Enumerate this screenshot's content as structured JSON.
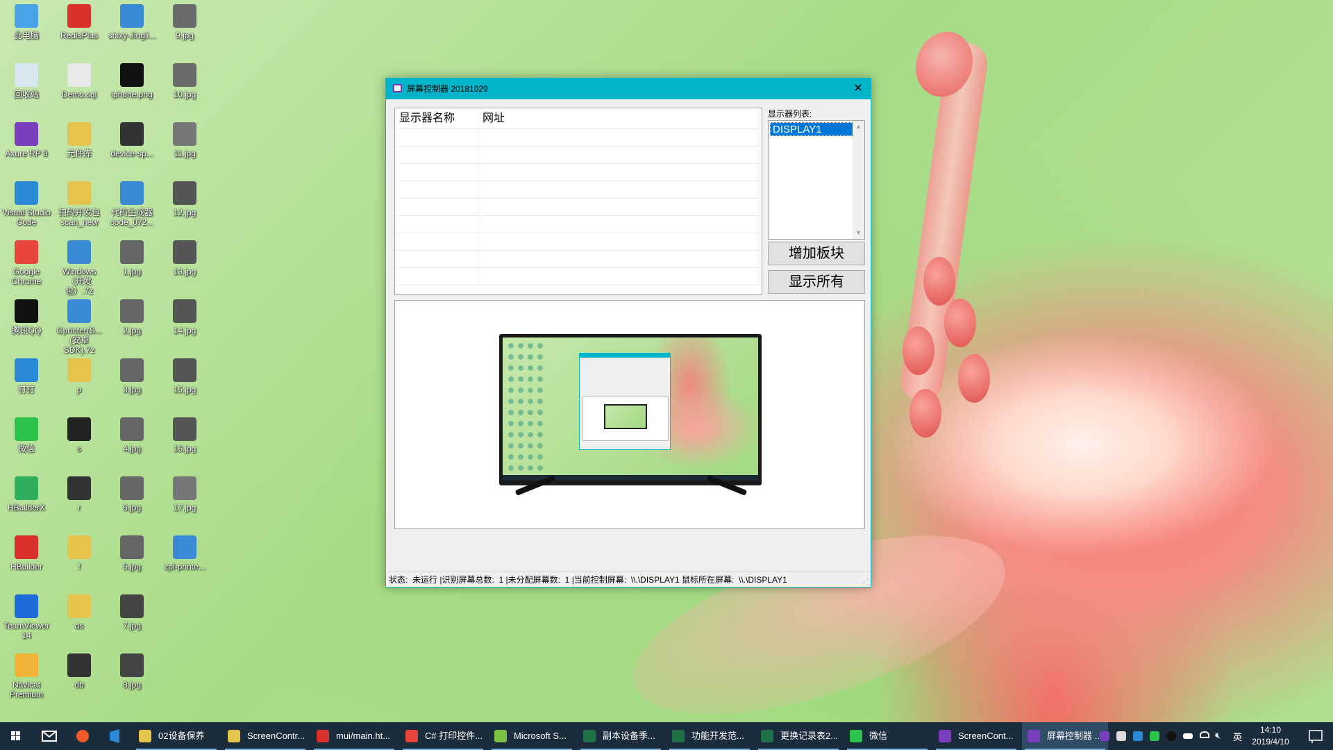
{
  "desktop": {
    "icons": [
      {
        "label": "此电脑",
        "color": "#4aa3e6"
      },
      {
        "label": "RedisPlus",
        "color": "#d9312b"
      },
      {
        "label": "shixy-Jingli...",
        "color": "#3a8ad6"
      },
      {
        "label": "9.jpg",
        "color": "#6b6b6b"
      },
      {
        "label": "回收站",
        "color": "#d7e6ef"
      },
      {
        "label": "Demo.sql",
        "color": "#e9e9e9"
      },
      {
        "label": "iphone.png",
        "color": "#111111"
      },
      {
        "label": "10.jpg",
        "color": "#6b6b6b"
      },
      {
        "label": "Axure RP 8",
        "color": "#7a3fbf"
      },
      {
        "label": "元件库",
        "color": "#e6c34d"
      },
      {
        "label": "device-sp...",
        "color": "#333333"
      },
      {
        "label": "11.jpg",
        "color": "#777777"
      },
      {
        "label": "Visual Studio Code",
        "color": "#2b8ad8"
      },
      {
        "label": "扫码开发包 scan_new",
        "color": "#e6c34d"
      },
      {
        "label": "代码生成器 code_072...",
        "color": "#3a8ad6"
      },
      {
        "label": "12.jpg",
        "color": "#555555"
      },
      {
        "label": "Google Chrome",
        "color": "#e7453b"
      },
      {
        "label": "Windows（开发包）.7z",
        "color": "#3a8ad6"
      },
      {
        "label": "1.jpg",
        "color": "#666666"
      },
      {
        "label": "13.jpg",
        "color": "#555555"
      },
      {
        "label": "腾讯QQ",
        "color": "#111111"
      },
      {
        "label": "Gprinter(S...(安卓SDK).7z",
        "color": "#3a8ad6"
      },
      {
        "label": "2.jpg",
        "color": "#666666"
      },
      {
        "label": "14.jpg",
        "color": "#555555"
      },
      {
        "label": "钉钉",
        "color": "#2b8ad8"
      },
      {
        "label": "p",
        "color": "#e6c34d"
      },
      {
        "label": "3.jpg",
        "color": "#666666"
      },
      {
        "label": "15.jpg",
        "color": "#555555"
      },
      {
        "label": "微信",
        "color": "#2dc24c"
      },
      {
        "label": "s",
        "color": "#222222"
      },
      {
        "label": "4.jpg",
        "color": "#666666"
      },
      {
        "label": "16.jpg",
        "color": "#555555"
      },
      {
        "label": "HBuilderX",
        "color": "#2dae5a"
      },
      {
        "label": "r",
        "color": "#333333"
      },
      {
        "label": "6.jpg",
        "color": "#666666"
      },
      {
        "label": "17.jpg",
        "color": "#777777"
      },
      {
        "label": "HBuilder",
        "color": "#d9312b"
      },
      {
        "label": "f",
        "color": "#e6c34d"
      },
      {
        "label": "5.jpg",
        "color": "#666666"
      },
      {
        "label": "zpl-printe...",
        "color": "#3a8ad6"
      },
      {
        "label": "TeamViewer 14",
        "color": "#1f6ad9"
      },
      {
        "label": "as",
        "color": "#e6c34d"
      },
      {
        "label": "7.jpg",
        "color": "#444444"
      },
      {
        "label": "",
        "color": ""
      },
      {
        "label": "Navicat Premium",
        "color": "#f1b436"
      },
      {
        "label": "db",
        "color": "#333333"
      },
      {
        "label": "8.jpg",
        "color": "#444444"
      }
    ]
  },
  "window": {
    "title": "屏幕控制器 20181029",
    "close_glyph": "✕",
    "grid_headers": [
      "显示器名称",
      "网址"
    ],
    "display_list_label": "显示器列表:",
    "display_items": [
      "DISPLAY1"
    ],
    "add_block_button": "增加板块",
    "show_all_button": "显示所有",
    "status": {
      "label": "状态:",
      "state": "未运行",
      "recognized_label": "|识别屏幕总数:",
      "recognized_count": "1",
      "unassigned_label": "|未分配屏幕数:",
      "unassigned_count": "1",
      "current_label": "|当前控制屏幕:",
      "current_value": "\\\\.\\DISPLAY1",
      "mouse_label": "鼠标所在屏幕:",
      "mouse_value": "\\\\.\\DISPLAY1"
    }
  },
  "taskbar": {
    "items": [
      {
        "label": "02设备保养",
        "color": "#e6c34d",
        "active": false
      },
      {
        "label": "ScreenContr...",
        "color": "#e6c34d",
        "active": false
      },
      {
        "label": "mui/main.ht...",
        "color": "#d9312b",
        "active": false
      },
      {
        "label": "C# 打印控件...",
        "color": "#e7453b",
        "active": false
      },
      {
        "label": "Microsoft S...",
        "color": "#7cc142",
        "active": false
      },
      {
        "label": "副本设备季...",
        "color": "#1e7145",
        "active": false
      },
      {
        "label": "功能开发范...",
        "color": "#1e7145",
        "active": false
      },
      {
        "label": "更换记录表2...",
        "color": "#1e7145",
        "active": false
      },
      {
        "label": "微信",
        "color": "#2dc24c",
        "active": false
      },
      {
        "label": "ScreenCont...",
        "color": "#7a3fbf",
        "active": false
      },
      {
        "label": "屏幕控制器 ...",
        "color": "#7a3fbf",
        "active": true
      }
    ],
    "tray_lang": "英",
    "time": "14:10",
    "date": "2019/4/10"
  }
}
